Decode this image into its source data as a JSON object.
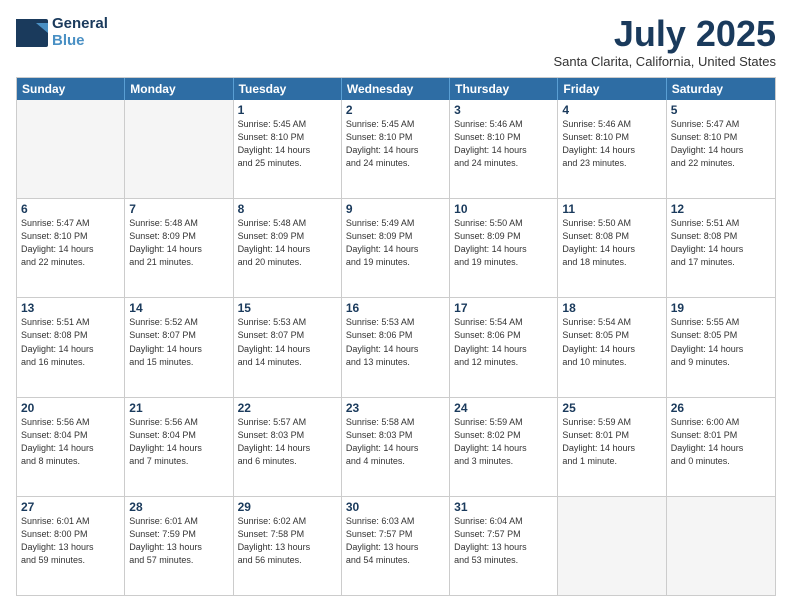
{
  "header": {
    "logo_line1": "General",
    "logo_line2": "Blue",
    "month_year": "July 2025",
    "location": "Santa Clarita, California, United States"
  },
  "day_headers": [
    "Sunday",
    "Monday",
    "Tuesday",
    "Wednesday",
    "Thursday",
    "Friday",
    "Saturday"
  ],
  "weeks": [
    [
      {
        "num": "",
        "info": ""
      },
      {
        "num": "",
        "info": ""
      },
      {
        "num": "1",
        "info": "Sunrise: 5:45 AM\nSunset: 8:10 PM\nDaylight: 14 hours\nand 25 minutes."
      },
      {
        "num": "2",
        "info": "Sunrise: 5:45 AM\nSunset: 8:10 PM\nDaylight: 14 hours\nand 24 minutes."
      },
      {
        "num": "3",
        "info": "Sunrise: 5:46 AM\nSunset: 8:10 PM\nDaylight: 14 hours\nand 24 minutes."
      },
      {
        "num": "4",
        "info": "Sunrise: 5:46 AM\nSunset: 8:10 PM\nDaylight: 14 hours\nand 23 minutes."
      },
      {
        "num": "5",
        "info": "Sunrise: 5:47 AM\nSunset: 8:10 PM\nDaylight: 14 hours\nand 22 minutes."
      }
    ],
    [
      {
        "num": "6",
        "info": "Sunrise: 5:47 AM\nSunset: 8:10 PM\nDaylight: 14 hours\nand 22 minutes."
      },
      {
        "num": "7",
        "info": "Sunrise: 5:48 AM\nSunset: 8:09 PM\nDaylight: 14 hours\nand 21 minutes."
      },
      {
        "num": "8",
        "info": "Sunrise: 5:48 AM\nSunset: 8:09 PM\nDaylight: 14 hours\nand 20 minutes."
      },
      {
        "num": "9",
        "info": "Sunrise: 5:49 AM\nSunset: 8:09 PM\nDaylight: 14 hours\nand 19 minutes."
      },
      {
        "num": "10",
        "info": "Sunrise: 5:50 AM\nSunset: 8:09 PM\nDaylight: 14 hours\nand 19 minutes."
      },
      {
        "num": "11",
        "info": "Sunrise: 5:50 AM\nSunset: 8:08 PM\nDaylight: 14 hours\nand 18 minutes."
      },
      {
        "num": "12",
        "info": "Sunrise: 5:51 AM\nSunset: 8:08 PM\nDaylight: 14 hours\nand 17 minutes."
      }
    ],
    [
      {
        "num": "13",
        "info": "Sunrise: 5:51 AM\nSunset: 8:08 PM\nDaylight: 14 hours\nand 16 minutes."
      },
      {
        "num": "14",
        "info": "Sunrise: 5:52 AM\nSunset: 8:07 PM\nDaylight: 14 hours\nand 15 minutes."
      },
      {
        "num": "15",
        "info": "Sunrise: 5:53 AM\nSunset: 8:07 PM\nDaylight: 14 hours\nand 14 minutes."
      },
      {
        "num": "16",
        "info": "Sunrise: 5:53 AM\nSunset: 8:06 PM\nDaylight: 14 hours\nand 13 minutes."
      },
      {
        "num": "17",
        "info": "Sunrise: 5:54 AM\nSunset: 8:06 PM\nDaylight: 14 hours\nand 12 minutes."
      },
      {
        "num": "18",
        "info": "Sunrise: 5:54 AM\nSunset: 8:05 PM\nDaylight: 14 hours\nand 10 minutes."
      },
      {
        "num": "19",
        "info": "Sunrise: 5:55 AM\nSunset: 8:05 PM\nDaylight: 14 hours\nand 9 minutes."
      }
    ],
    [
      {
        "num": "20",
        "info": "Sunrise: 5:56 AM\nSunset: 8:04 PM\nDaylight: 14 hours\nand 8 minutes."
      },
      {
        "num": "21",
        "info": "Sunrise: 5:56 AM\nSunset: 8:04 PM\nDaylight: 14 hours\nand 7 minutes."
      },
      {
        "num": "22",
        "info": "Sunrise: 5:57 AM\nSunset: 8:03 PM\nDaylight: 14 hours\nand 6 minutes."
      },
      {
        "num": "23",
        "info": "Sunrise: 5:58 AM\nSunset: 8:03 PM\nDaylight: 14 hours\nand 4 minutes."
      },
      {
        "num": "24",
        "info": "Sunrise: 5:59 AM\nSunset: 8:02 PM\nDaylight: 14 hours\nand 3 minutes."
      },
      {
        "num": "25",
        "info": "Sunrise: 5:59 AM\nSunset: 8:01 PM\nDaylight: 14 hours\nand 1 minute."
      },
      {
        "num": "26",
        "info": "Sunrise: 6:00 AM\nSunset: 8:01 PM\nDaylight: 14 hours\nand 0 minutes."
      }
    ],
    [
      {
        "num": "27",
        "info": "Sunrise: 6:01 AM\nSunset: 8:00 PM\nDaylight: 13 hours\nand 59 minutes."
      },
      {
        "num": "28",
        "info": "Sunrise: 6:01 AM\nSunset: 7:59 PM\nDaylight: 13 hours\nand 57 minutes."
      },
      {
        "num": "29",
        "info": "Sunrise: 6:02 AM\nSunset: 7:58 PM\nDaylight: 13 hours\nand 56 minutes."
      },
      {
        "num": "30",
        "info": "Sunrise: 6:03 AM\nSunset: 7:57 PM\nDaylight: 13 hours\nand 54 minutes."
      },
      {
        "num": "31",
        "info": "Sunrise: 6:04 AM\nSunset: 7:57 PM\nDaylight: 13 hours\nand 53 minutes."
      },
      {
        "num": "",
        "info": ""
      },
      {
        "num": "",
        "info": ""
      }
    ]
  ]
}
